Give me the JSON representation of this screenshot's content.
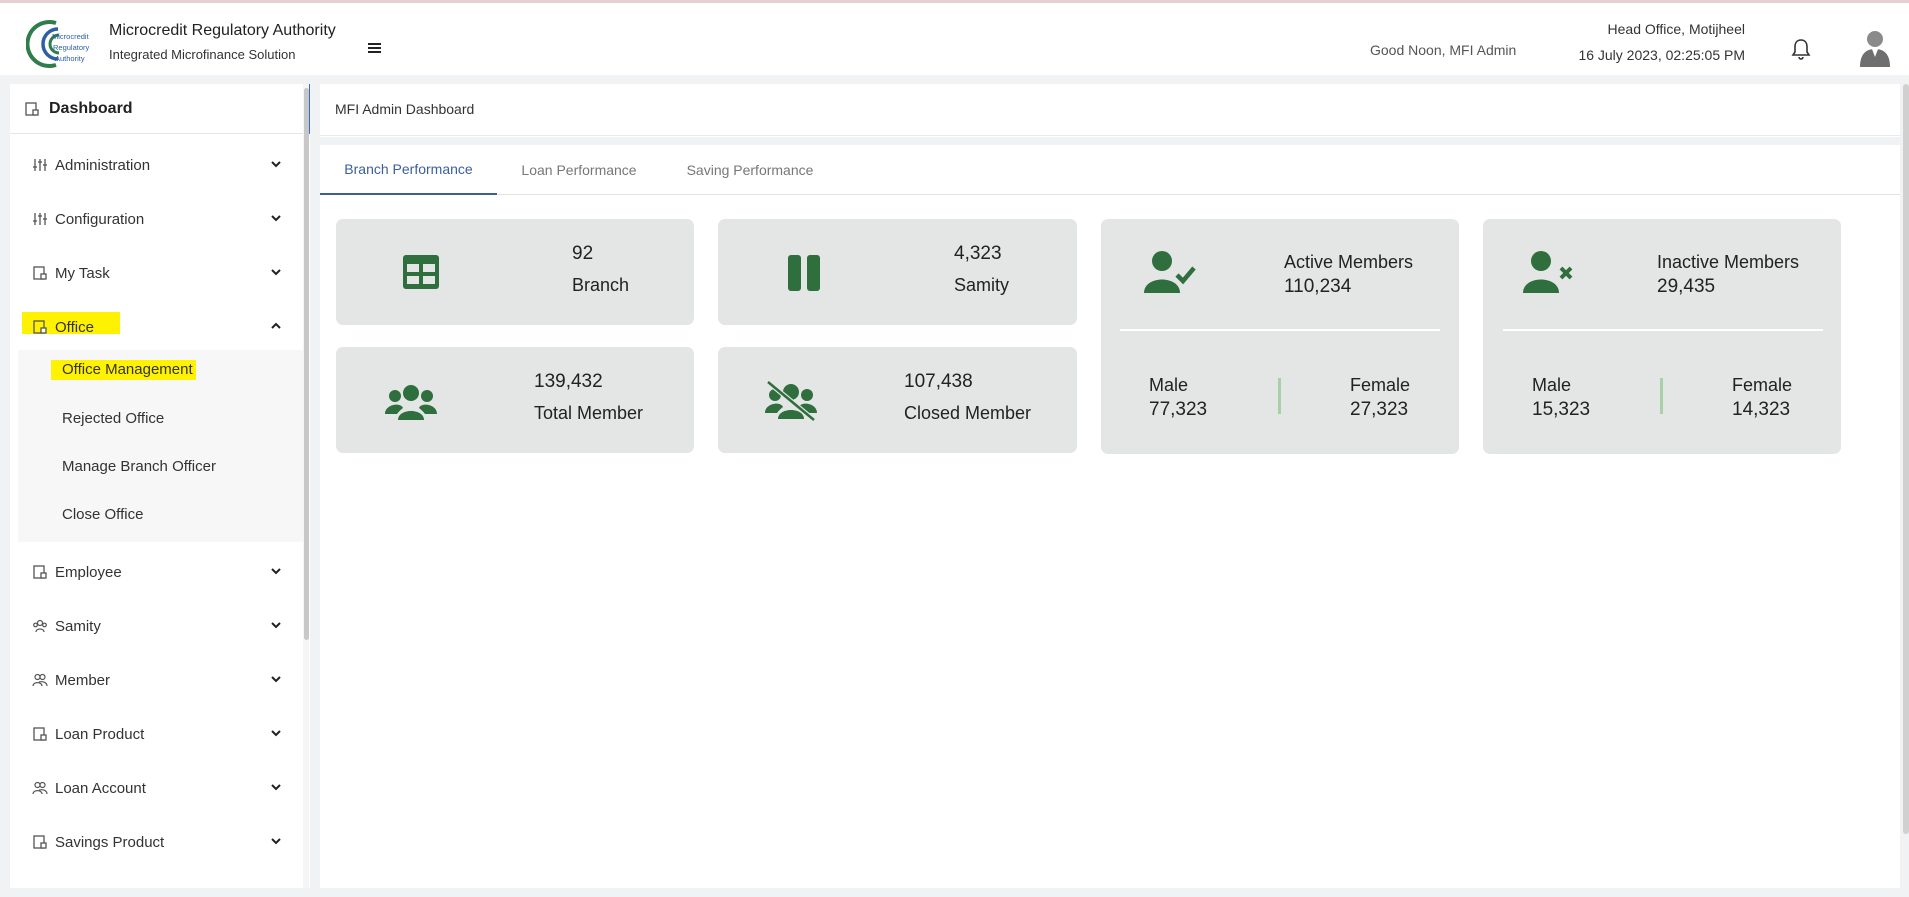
{
  "colors": {
    "accent": "#3b5f9a",
    "icon_green": "#2f6e3d",
    "highlight": "#fff200"
  },
  "header": {
    "brand_title": "Microcredit Regulatory Authority",
    "brand_subtitle": "Integrated Microfinance Solution",
    "logo_text": [
      "Microcredit",
      "Regulatory",
      "Authority"
    ],
    "greeting": "Good Noon, MFI Admin",
    "office": "Head Office, Motijheel",
    "datetime": "16 July 2023, 02:25:05 PM"
  },
  "sidebar": {
    "dashboard_label": "Dashboard",
    "items": [
      {
        "label": "Administration",
        "icon": "sliders-icon",
        "expanded": false
      },
      {
        "label": "Configuration",
        "icon": "sliders-icon",
        "expanded": false
      },
      {
        "label": "My Task",
        "icon": "document-icon",
        "expanded": false
      },
      {
        "label": "Office",
        "icon": "document-icon",
        "expanded": true
      },
      {
        "label": "Employee",
        "icon": "document-icon",
        "expanded": false
      },
      {
        "label": "Samity",
        "icon": "group-icon",
        "expanded": false
      },
      {
        "label": "Member",
        "icon": "users-icon",
        "expanded": false
      },
      {
        "label": "Loan Product",
        "icon": "document-icon",
        "expanded": false
      },
      {
        "label": "Loan Account",
        "icon": "users-icon",
        "expanded": false
      },
      {
        "label": "Savings Product",
        "icon": "document-icon",
        "expanded": false
      }
    ],
    "office_submenu": [
      "Office Management",
      "Rejected Office",
      "Manage Branch Officer",
      "Close Office"
    ]
  },
  "main": {
    "breadcrumb": "MFI Admin Dashboard",
    "tabs": [
      "Branch Performance",
      "Loan Performance",
      "Saving Performance"
    ],
    "active_tab": "Branch Performance",
    "stats": {
      "branch": {
        "value": "92",
        "label": "Branch"
      },
      "samity": {
        "value": "4,323",
        "label": "Samity"
      },
      "total_member": {
        "value": "139,432",
        "label": "Total Member"
      },
      "closed_member": {
        "value": "107,438",
        "label": "Closed Member"
      }
    },
    "active_members": {
      "title": "Active Members",
      "value": "110,234",
      "male_label": "Male",
      "male_value": "77,323",
      "female_label": "Female",
      "female_value": "27,323"
    },
    "inactive_members": {
      "title": "Inactive Members",
      "value": "29,435",
      "male_label": "Male",
      "male_value": "15,323",
      "female_label": "Female",
      "female_value": "14,323"
    }
  }
}
